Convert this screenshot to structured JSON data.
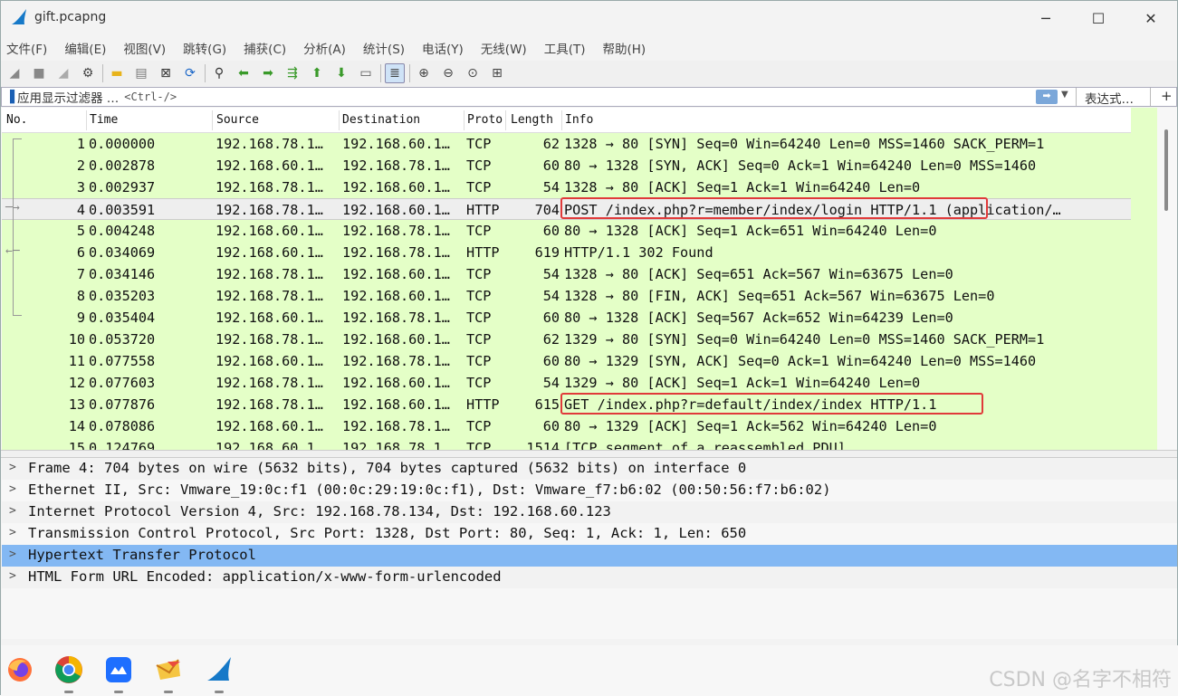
{
  "window": {
    "title": "gift.pcapng",
    "minimize": "─",
    "maximize": "☐",
    "close": "✕"
  },
  "menu": [
    "文件(F)",
    "编辑(E)",
    "视图(V)",
    "跳转(G)",
    "捕获(C)",
    "分析(A)",
    "统计(S)",
    "电话(Y)",
    "无线(W)",
    "工具(T)",
    "帮助(H)"
  ],
  "toolbar": [
    {
      "icon": "shark-fin-start-icon",
      "glyph": "◢"
    },
    {
      "icon": "stop-capture-icon",
      "glyph": "■"
    },
    {
      "icon": "restart-capture-icon",
      "glyph": "◢"
    },
    {
      "icon": "capture-options-icon",
      "glyph": "⚙"
    },
    {
      "icon": "open-file-icon",
      "glyph": "▬"
    },
    {
      "icon": "save-file-icon",
      "glyph": "▤"
    },
    {
      "icon": "close-file-icon",
      "glyph": "⊠"
    },
    {
      "icon": "reload-file-icon",
      "glyph": "⟳"
    },
    {
      "icon": "find-packet-icon",
      "glyph": "🔍"
    },
    {
      "icon": "go-back-icon",
      "glyph": "⬅"
    },
    {
      "icon": "go-forward-icon",
      "glyph": "➡"
    },
    {
      "icon": "go-to-packet-icon",
      "glyph": "⇶"
    },
    {
      "icon": "go-first-icon",
      "glyph": "⬆"
    },
    {
      "icon": "go-last-icon",
      "glyph": "⬇"
    },
    {
      "icon": "autoscroll-icon",
      "glyph": "▭"
    },
    {
      "icon": "colorize-icon",
      "glyph": "≣"
    },
    {
      "icon": "zoom-in-icon",
      "glyph": "⊕"
    },
    {
      "icon": "zoom-out-icon",
      "glyph": "⊖"
    },
    {
      "icon": "zoom-normal-icon",
      "glyph": "⊙"
    },
    {
      "icon": "resize-columns-icon",
      "glyph": "⊞"
    }
  ],
  "filter": {
    "label": "应用显示过滤器 …",
    "placeholder": "<Ctrl-/>",
    "expression_label": "表达式…",
    "plus": "+"
  },
  "columns": {
    "no": "No.",
    "time": "Time",
    "source": "Source",
    "destination": "Destination",
    "protocol": "Protocol",
    "length": "Length",
    "info": "Info"
  },
  "packets": [
    {
      "no": "1",
      "time": "0.000000",
      "src": "192.168.78.1…",
      "dst": "192.168.60.1…",
      "proto": "TCP",
      "len": "62",
      "info": "1328 → 80 [SYN] Seq=0 Win=64240 Len=0 MSS=1460 SACK_PERM=1"
    },
    {
      "no": "2",
      "time": "0.002878",
      "src": "192.168.60.1…",
      "dst": "192.168.78.1…",
      "proto": "TCP",
      "len": "60",
      "info": "80 → 1328 [SYN, ACK] Seq=0 Ack=1 Win=64240 Len=0 MSS=1460"
    },
    {
      "no": "3",
      "time": "0.002937",
      "src": "192.168.78.1…",
      "dst": "192.168.60.1…",
      "proto": "TCP",
      "len": "54",
      "info": "1328 → 80 [ACK] Seq=1 Ack=1 Win=64240 Len=0"
    },
    {
      "no": "4",
      "time": "0.003591",
      "src": "192.168.78.1…",
      "dst": "192.168.60.1…",
      "proto": "HTTP",
      "len": "704",
      "info": "POST /index.php?r=member/index/login HTTP/1.1  (application/…"
    },
    {
      "no": "5",
      "time": "0.004248",
      "src": "192.168.60.1…",
      "dst": "192.168.78.1…",
      "proto": "TCP",
      "len": "60",
      "info": "80 → 1328 [ACK] Seq=1 Ack=651 Win=64240 Len=0"
    },
    {
      "no": "6",
      "time": "0.034069",
      "src": "192.168.60.1…",
      "dst": "192.168.78.1…",
      "proto": "HTTP",
      "len": "619",
      "info": "HTTP/1.1 302 Found"
    },
    {
      "no": "7",
      "time": "0.034146",
      "src": "192.168.78.1…",
      "dst": "192.168.60.1…",
      "proto": "TCP",
      "len": "54",
      "info": "1328 → 80 [ACK] Seq=651 Ack=567 Win=63675 Len=0"
    },
    {
      "no": "8",
      "time": "0.035203",
      "src": "192.168.78.1…",
      "dst": "192.168.60.1…",
      "proto": "TCP",
      "len": "54",
      "info": "1328 → 80 [FIN, ACK] Seq=651 Ack=567 Win=63675 Len=0"
    },
    {
      "no": "9",
      "time": "0.035404",
      "src": "192.168.60.1…",
      "dst": "192.168.78.1…",
      "proto": "TCP",
      "len": "60",
      "info": "80 → 1328 [ACK] Seq=567 Ack=652 Win=64239 Len=0"
    },
    {
      "no": "10",
      "time": "0.053720",
      "src": "192.168.78.1…",
      "dst": "192.168.60.1…",
      "proto": "TCP",
      "len": "62",
      "info": "1329 → 80 [SYN] Seq=0 Win=64240 Len=0 MSS=1460 SACK_PERM=1"
    },
    {
      "no": "11",
      "time": "0.077558",
      "src": "192.168.60.1…",
      "dst": "192.168.78.1…",
      "proto": "TCP",
      "len": "60",
      "info": "80 → 1329 [SYN, ACK] Seq=0 Ack=1 Win=64240 Len=0 MSS=1460"
    },
    {
      "no": "12",
      "time": "0.077603",
      "src": "192.168.78.1…",
      "dst": "192.168.60.1…",
      "proto": "TCP",
      "len": "54",
      "info": "1329 → 80 [ACK] Seq=1 Ack=1 Win=64240 Len=0"
    },
    {
      "no": "13",
      "time": "0.077876",
      "src": "192.168.78.1…",
      "dst": "192.168.60.1…",
      "proto": "HTTP",
      "len": "615",
      "info": "GET /index.php?r=default/index/index HTTP/1.1"
    },
    {
      "no": "14",
      "time": "0.078086",
      "src": "192.168.60.1…",
      "dst": "192.168.78.1…",
      "proto": "TCP",
      "len": "60",
      "info": "80 → 1329 [ACK] Seq=1 Ack=562 Win=64240 Len=0"
    },
    {
      "no": "15",
      "time": "0.124769",
      "src": "192.168.60.1…",
      "dst": "192.168.78.1…",
      "proto": "TCP",
      "len": "1514",
      "info": "[TCP segment of a reassembled PDU]"
    }
  ],
  "selected_packet": "4",
  "details": [
    "Frame 4: 704 bytes on wire (5632 bits), 704 bytes captured (5632 bits) on interface 0",
    "Ethernet II, Src: Vmware_19:0c:f1 (00:0c:29:19:0c:f1), Dst: Vmware_f7:b6:02 (00:50:56:f7:b6:02)",
    "Internet Protocol Version 4, Src: 192.168.78.134, Dst: 192.168.60.123",
    "Transmission Control Protocol, Src Port: 1328, Dst Port: 80, Seq: 1, Ack: 1, Len: 650",
    "Hypertext Transfer Protocol",
    "HTML Form URL Encoded: application/x-www-form-urlencoded"
  ],
  "selected_detail": "Hypertext Transfer Protocol",
  "taskbar": [
    {
      "name": "firefox-icon"
    },
    {
      "name": "chrome-icon"
    },
    {
      "name": "lark-icon"
    },
    {
      "name": "mail-app-icon"
    },
    {
      "name": "wireshark-icon"
    }
  ],
  "watermark": "CSDN @名字不相符",
  "colors": {
    "tcp_row": "#e4ffc7",
    "selected_row": "#eeeeee",
    "highlight_box": "#e03a3a",
    "selected_detail": "#83b8f3"
  }
}
